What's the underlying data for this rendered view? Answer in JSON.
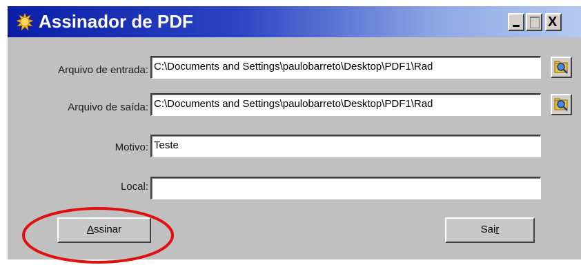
{
  "window": {
    "title": "Assinador de PDF",
    "controls": {
      "close_glyph": "X"
    }
  },
  "form": {
    "input_file": {
      "label": "Arquivo de entrada:",
      "value": "C:\\Documents and Settings\\paulobarreto\\Desktop\\PDF1\\Rad"
    },
    "output_file": {
      "label": "Arquivo de saída:",
      "value": "C:\\Documents and Settings\\paulobarreto\\Desktop\\PDF1\\Rad"
    },
    "reason": {
      "label": "Motivo:",
      "value": "Teste"
    },
    "location": {
      "label": "Local:",
      "value": ""
    }
  },
  "buttons": {
    "sign": {
      "label_mnemonic": "A",
      "label_rest": "ssinar"
    },
    "exit": {
      "label_start": "Sai",
      "label_mnemonic": "r"
    }
  },
  "annotation": {
    "highlight_color": "#e01010",
    "icons": [
      "sun-icon",
      "folder-search-icon",
      "circle-annotation"
    ]
  }
}
